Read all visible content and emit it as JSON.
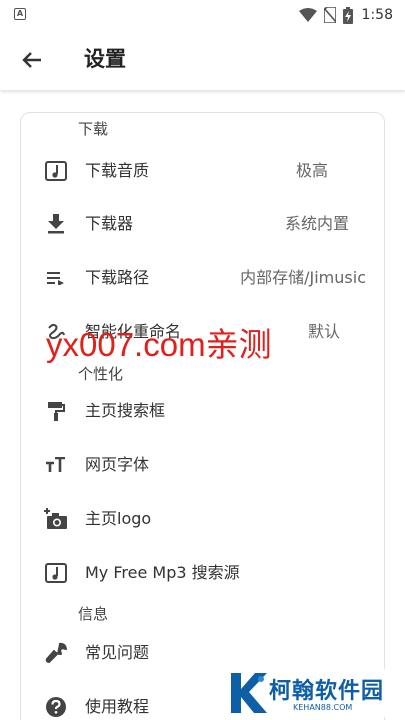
{
  "status_bar": {
    "app_badge": "A",
    "time": "1:58"
  },
  "app_bar": {
    "title": "设置",
    "back_icon": "arrow-back-icon"
  },
  "sections": {
    "download": {
      "header": "下载",
      "items": [
        {
          "icon": "music-note-icon",
          "label": "下载音质",
          "value": "极高"
        },
        {
          "icon": "download-icon",
          "label": "下载器",
          "value": "系统内置"
        },
        {
          "icon": "playlist-icon",
          "label": "下载路径",
          "value": "内部存储/Jimusic"
        },
        {
          "icon": "gesture-icon",
          "label": "智能化重命名",
          "value": "默认"
        }
      ]
    },
    "personalize": {
      "header": "个性化",
      "items": [
        {
          "icon": "paint-roller-icon",
          "label": "主页搜索框"
        },
        {
          "icon": "font-size-icon",
          "label": "网页字体"
        },
        {
          "icon": "add-photo-icon",
          "label": "主页logo"
        },
        {
          "icon": "music-note-icon",
          "label": "My Free Mp3 搜索源"
        }
      ]
    },
    "info": {
      "header": "信息",
      "items": [
        {
          "icon": "wrench-icon",
          "label": "常见问题"
        },
        {
          "icon": "help-circle-icon",
          "label": "使用教程"
        }
      ]
    }
  },
  "watermark": {
    "text": "yx007.com亲测",
    "color": "#e0201b"
  },
  "brand": {
    "name": "柯翰软件园",
    "subtitle": "KEHAN88.COM",
    "color": "#0f5ea8"
  },
  "colors": {
    "icon": "#444444",
    "text": "#333333",
    "value_text": "#666666"
  }
}
